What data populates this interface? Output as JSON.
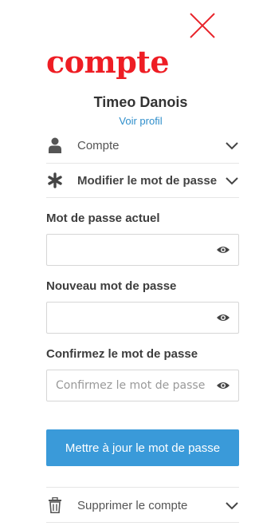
{
  "brand": {
    "logo_text": "compte",
    "logo_color": "#ee1d24"
  },
  "header": {
    "close_icon": "close-icon"
  },
  "profile": {
    "name": "Timeo Danois",
    "view_profile_label": "Voir profil"
  },
  "menu": {
    "account": {
      "label": "Compte",
      "icon": "user-icon"
    },
    "change_password": {
      "label": "Modifier le mot de passe",
      "icon": "asterisk-icon"
    },
    "delete_account": {
      "label": "Supprimer le compte",
      "icon": "trash-icon"
    }
  },
  "form": {
    "current_password": {
      "label": "Mot de passe actuel",
      "value": "",
      "placeholder": ""
    },
    "new_password": {
      "label": "Nouveau mot de passe",
      "value": "",
      "placeholder": ""
    },
    "confirm_password": {
      "label": "Confirmez le mot de passe",
      "value": "",
      "placeholder": "Confirmez le mot de passe"
    },
    "submit_label": "Mettre à jour le mot de passe",
    "submit_color": "#3a9ad9"
  }
}
